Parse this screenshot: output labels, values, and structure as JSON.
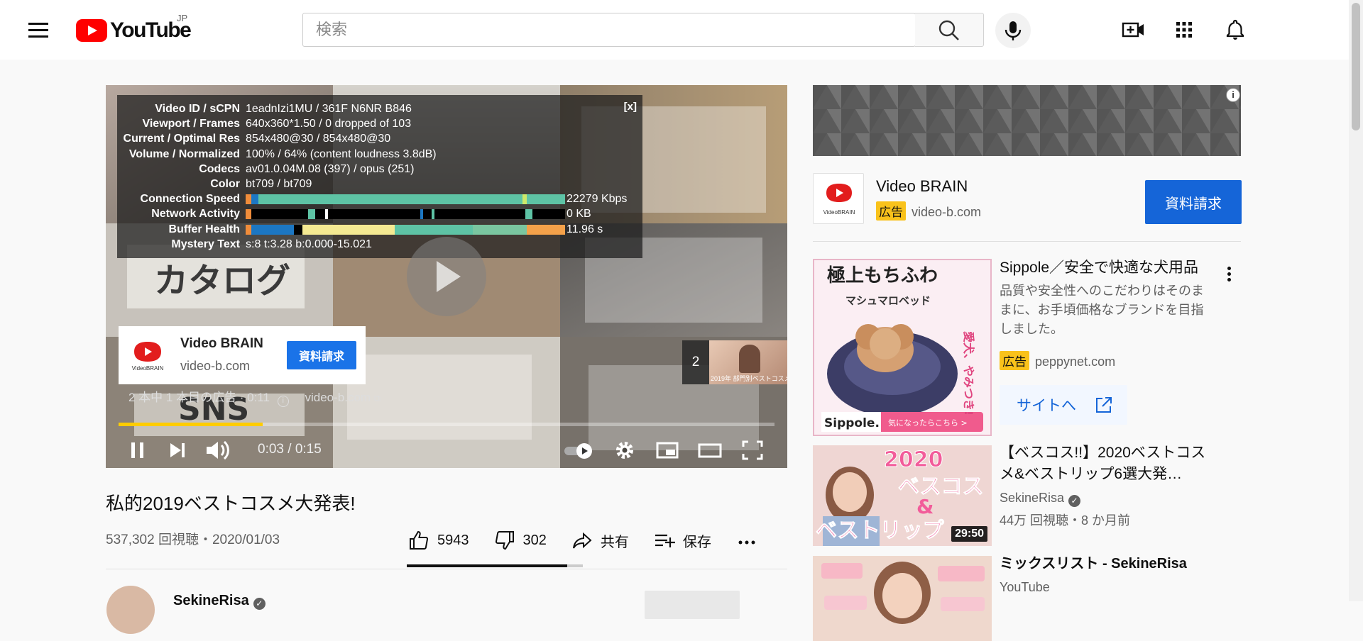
{
  "header": {
    "logo_text": "YouTube",
    "region": "JP",
    "search_placeholder": "検索"
  },
  "player": {
    "stats": [
      {
        "label": "Video ID / sCPN",
        "value": "1eadnIzi1MU / 361F N6NR B846"
      },
      {
        "label": "Viewport / Frames",
        "value": "640x360*1.50 / 0 dropped of 103"
      },
      {
        "label": "Current / Optimal Res",
        "value": "854x480@30 / 854x480@30"
      },
      {
        "label": "Volume / Normalized",
        "value": "100% / 64% (content loudness 3.8dB)"
      },
      {
        "label": "Codecs",
        "value": "av01.0.04M.08 (397) / opus (251)"
      },
      {
        "label": "Color",
        "value": "bt709 / bt709"
      },
      {
        "label": "Connection Speed",
        "value": "22279 Kbps"
      },
      {
        "label": "Network Activity",
        "value": "0 KB"
      },
      {
        "label": "Buffer Health",
        "value": "11.96 s"
      },
      {
        "label": "Mystery Text",
        "value": "s:8 t:3.28 b:0.000-15.021"
      }
    ],
    "stats_close": "[x]",
    "collage_text_1": "カタログ",
    "collage_text_2": "SNS",
    "ad_card": {
      "name": "Video BRAIN",
      "domain": "video-b.com",
      "cta": "資料請求"
    },
    "ad_logo_caption": "VideoBRAIN",
    "ad_info": "2 本中 1 本目の広告 · 0:11",
    "ad_link": "video-b.com",
    "up_next_count": "2",
    "up_next_caption": "2019年 部門別ベストコスメ",
    "progress": 0.22,
    "time": "0:03 / 0:15"
  },
  "video": {
    "title": "私的2019ベストコスメ大発表!",
    "views": "537,302 回視聴・2020/01/03",
    "likes": "5943",
    "dislikes": "302",
    "share": "共有",
    "save": "保存",
    "channel": "SekineRisa"
  },
  "sidebar": {
    "ad": {
      "name": "Video BRAIN",
      "badge": "広告",
      "domain": "video-b.com",
      "cta": "資料請求",
      "logo_caption": "VideoBRAIN"
    },
    "promo": {
      "title": "Sippole／安全で快適な犬用品",
      "desc": "品質や安全性へのこだわりはそのままに、お手頃価格なブランドを目指しました。",
      "badge": "広告",
      "domain": "peppynet.com",
      "site_btn": "サイトへ",
      "thumb_top": "極上もちふわ",
      "thumb_sub": "マシュマロベッド",
      "thumb_side": "愛犬、やみつき!",
      "thumb_brand": "Sippole.",
      "thumb_cta": "気になったらこちら >"
    },
    "rec1": {
      "title": "【ベスコス!!】2020ベストコスメ&ベストリップ6選大発…",
      "channel": "SekineRisa",
      "meta": "44万 回視聴・8 か月前",
      "duration": "29:50",
      "thumb_line1": "2020",
      "thumb_line2": "ベスコス",
      "thumb_line3": "&",
      "thumb_line4": "ベストリップ"
    },
    "rec2": {
      "title": "ミックスリスト - SekineRisa",
      "channel": "YouTube"
    }
  }
}
